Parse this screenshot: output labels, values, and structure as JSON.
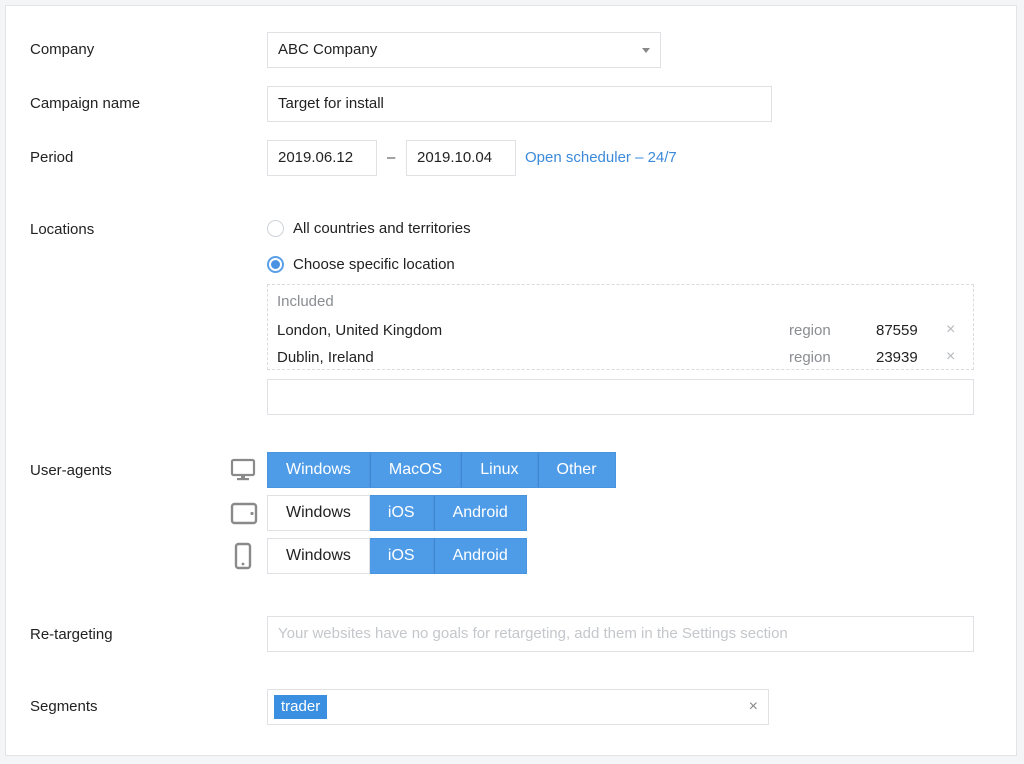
{
  "form": {
    "company": {
      "label": "Company",
      "value": "ABC Company"
    },
    "campaign_name": {
      "label": "Campaign name",
      "value": "Target for install"
    },
    "period": {
      "label": "Period",
      "start": "2019.06.12",
      "separator": "–",
      "end": "2019.10.04",
      "scheduler_link": "Open scheduler – 24/7"
    },
    "locations": {
      "label": "Locations",
      "options": [
        {
          "label": "All countries and territories",
          "checked": false
        },
        {
          "label": "Choose specific location",
          "checked": true
        }
      ],
      "included_header": "Included",
      "items": [
        {
          "name": "London, United Kingdom",
          "type": "region",
          "count": "87559"
        },
        {
          "name": "Dublin, Ireland",
          "type": "region",
          "count": "23939"
        }
      ],
      "search_value": ""
    },
    "user_agents": {
      "label": "User-agents",
      "desktop": [
        {
          "label": "Windows",
          "on": true
        },
        {
          "label": "MacOS",
          "on": true
        },
        {
          "label": "Linux",
          "on": true
        },
        {
          "label": "Other",
          "on": true
        }
      ],
      "tablet": [
        {
          "label": "Windows",
          "on": false
        },
        {
          "label": "iOS",
          "on": true
        },
        {
          "label": "Android",
          "on": true
        }
      ],
      "mobile": [
        {
          "label": "Windows",
          "on": false
        },
        {
          "label": "iOS",
          "on": true
        },
        {
          "label": "Android",
          "on": true
        }
      ]
    },
    "retargeting": {
      "label": "Re-targeting",
      "placeholder": "Your websites have no goals for retargeting, add them in the Settings section"
    },
    "segments": {
      "label": "Segments",
      "tags": [
        "trader"
      ],
      "clear_icon": "×"
    }
  },
  "icons": {
    "remove": "×"
  },
  "colors": {
    "accent": "#4e9ce8",
    "link": "#3b8ad9",
    "tag": "#3b8fe0"
  }
}
